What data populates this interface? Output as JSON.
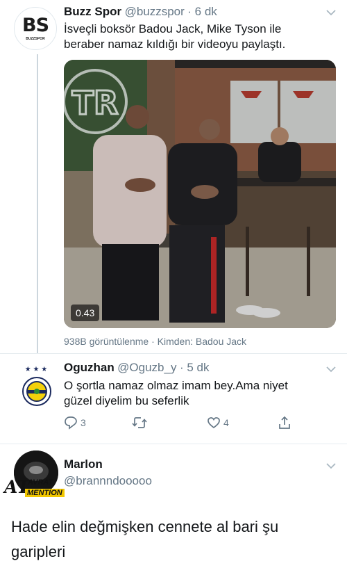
{
  "tweet1": {
    "avatar_text": "BS",
    "avatar_sub": "BUZZSPOR",
    "name": "Buzz Spor",
    "handle": "@buzzspor",
    "time": "· 6 dk",
    "text_line1": "İsveçli boksör Badou Jack, Mike Tyson ile",
    "text_line2": "beraber namaz kıldığı bir videoyu paylaştı.",
    "video_duration": "0.43",
    "sign_text": "TR",
    "views": "938B görüntülenme",
    "from": "· Kimden: Badou Jack"
  },
  "tweet2": {
    "avatar_stars": "★ ★ ★",
    "name": "Oguzhan",
    "handle": "@Oguzb_y",
    "time": "· 5 dk",
    "text_line1": "O şortla namaz olmaz imam bey.Ama niyet",
    "text_line2": "güzel diyelim bu seferlik",
    "reply_count": "3",
    "like_count": "4"
  },
  "tweet3": {
    "name": "Marlon",
    "handle": "@brannndooooo",
    "watermark_line1": "AVRAT",
    "watermark_line2": "MENTION",
    "watermark_at": "AT",
    "text_line1": "Hade elin değmişken cennete al bari şu",
    "text_line2": "garipleri"
  },
  "colors": {
    "muted": "#657786",
    "line": "#ccd6dd",
    "ink": "#14171a"
  }
}
